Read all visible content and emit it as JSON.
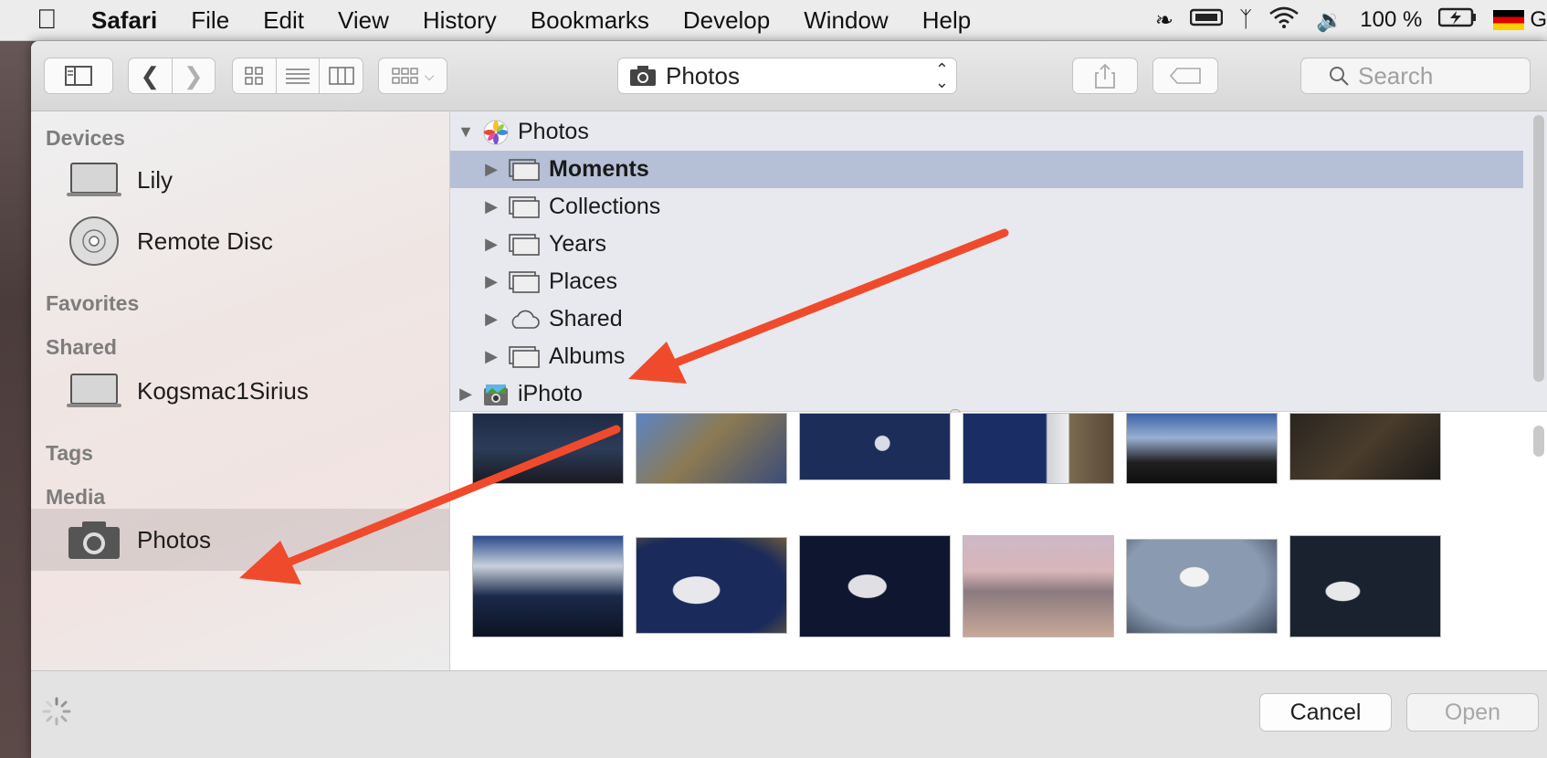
{
  "menubar": {
    "app": "Safari",
    "items": [
      "File",
      "Edit",
      "View",
      "History",
      "Bookmarks",
      "Develop",
      "Window",
      "Help"
    ],
    "battery": "100 %"
  },
  "toolbar": {
    "location": "Photos",
    "search_placeholder": "Search"
  },
  "sidebar": {
    "devices_header": "Devices",
    "devices": [
      "Lily",
      "Remote Disc"
    ],
    "favorites_header": "Favorites",
    "shared_header": "Shared",
    "shared": [
      "Kogsmac1Sirius"
    ],
    "tags_header": "Tags",
    "media_header": "Media",
    "media": [
      "Photos"
    ]
  },
  "tree": {
    "root": "Photos",
    "children": [
      "Moments",
      "Collections",
      "Years",
      "Places",
      "Shared",
      "Albums"
    ],
    "selected": "Moments",
    "iphoto": "iPhoto"
  },
  "footer": {
    "cancel": "Cancel",
    "open": "Open"
  },
  "colors": {
    "selection": "#b5c0d6",
    "arrow": "#f04a2c"
  }
}
